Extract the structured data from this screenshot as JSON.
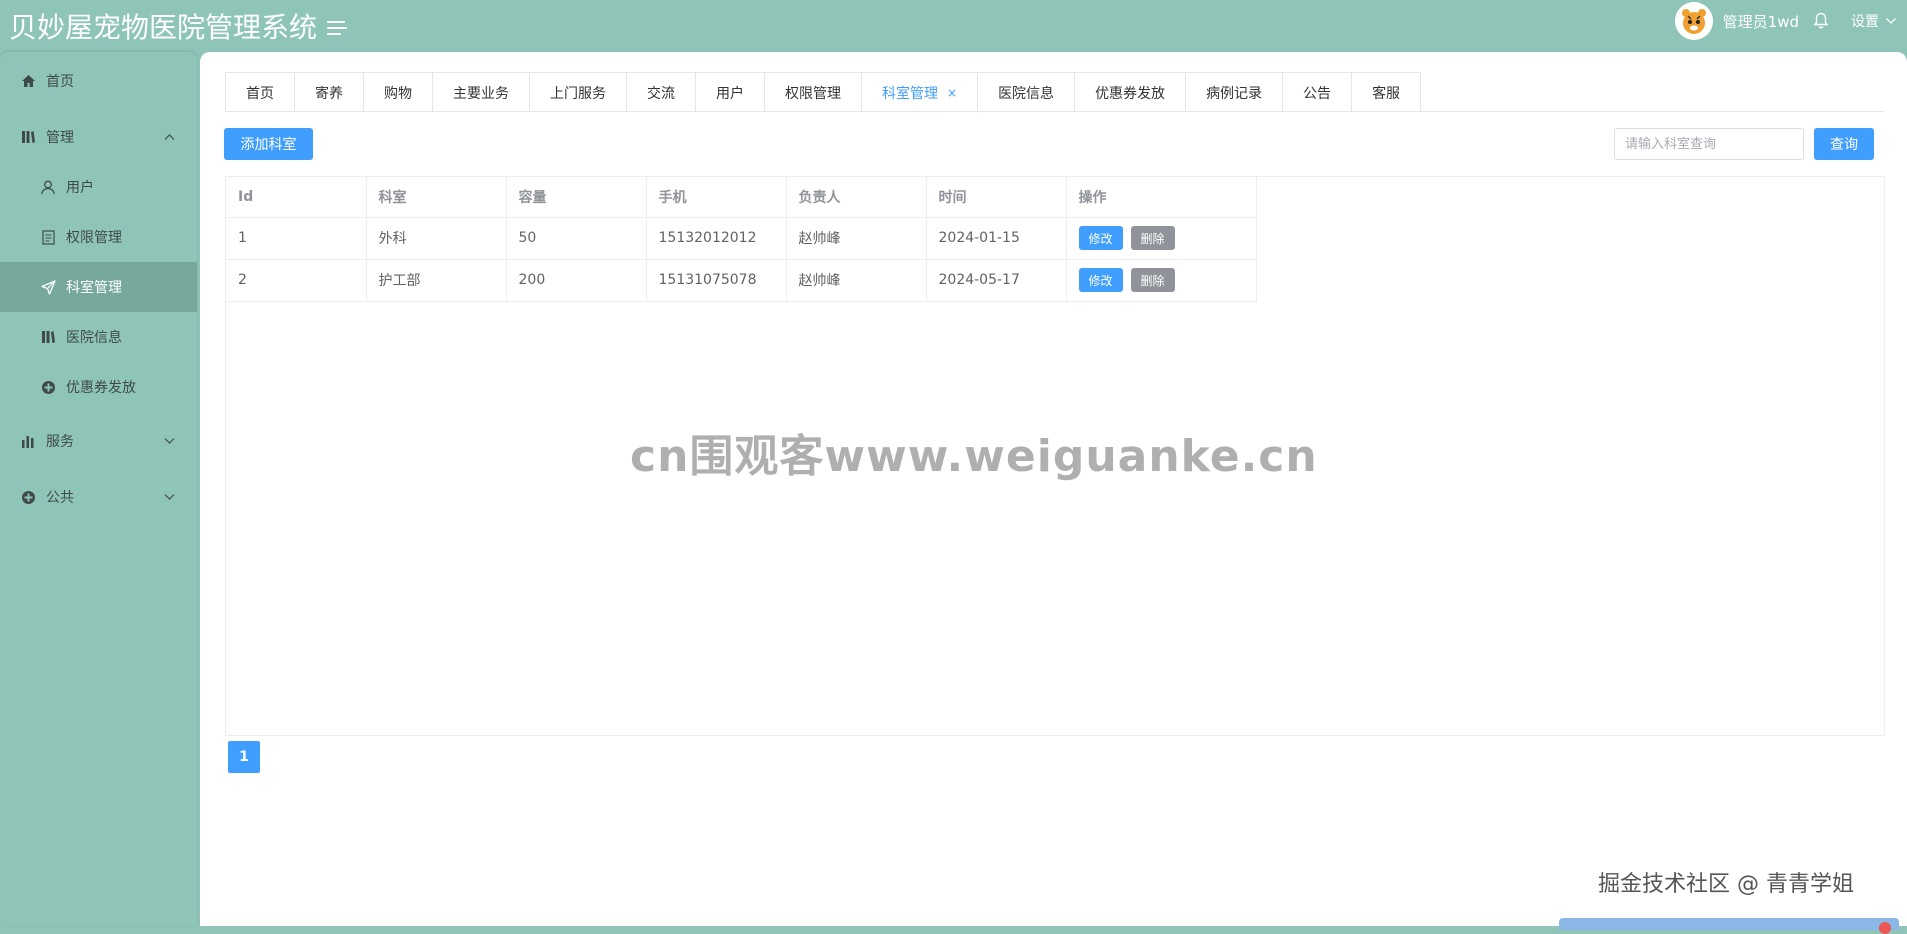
{
  "header": {
    "app_title": "贝妙屋宠物医院管理系统",
    "username": "管理员1wd",
    "settings_label": "设置"
  },
  "sidebar": {
    "items": [
      {
        "label": "首页",
        "icon": "home-icon"
      },
      {
        "label": "管理",
        "icon": "book-icon"
      },
      {
        "label": "用户",
        "icon": "user-icon"
      },
      {
        "label": "权限管理",
        "icon": "document-icon"
      },
      {
        "label": "科室管理",
        "icon": "send-icon"
      },
      {
        "label": "医院信息",
        "icon": "book-icon"
      },
      {
        "label": "优惠券发放",
        "icon": "circle-plus-icon"
      },
      {
        "label": "服务",
        "icon": "bar-chart-icon"
      },
      {
        "label": "公共",
        "icon": "circle-plus-icon"
      }
    ]
  },
  "tabs": [
    {
      "label": "首页"
    },
    {
      "label": "寄养"
    },
    {
      "label": "购物"
    },
    {
      "label": "主要业务"
    },
    {
      "label": "上门服务"
    },
    {
      "label": "交流"
    },
    {
      "label": "用户"
    },
    {
      "label": "权限管理"
    },
    {
      "label": "科室管理",
      "close": "×"
    },
    {
      "label": "医院信息"
    },
    {
      "label": "优惠券发放"
    },
    {
      "label": "病例记录"
    },
    {
      "label": "公告"
    },
    {
      "label": "客服"
    }
  ],
  "toolbar": {
    "add_label": "添加科室",
    "search_placeholder": "请输入科室查询",
    "search_label": "查询"
  },
  "table": {
    "headers": [
      "Id",
      "科室",
      "容量",
      "手机",
      "负责人",
      "时间",
      "操作"
    ],
    "rows": [
      [
        "1",
        "外科",
        "50",
        "15132012012",
        "赵帅峰",
        "2024-01-15"
      ],
      [
        "2",
        "护工部",
        "200",
        "15131075078",
        "赵帅峰",
        "2024-05-17"
      ]
    ],
    "edit_label": "修改",
    "delete_label": "删除"
  },
  "pagination": {
    "current": "1"
  },
  "watermark": "cn围观客www.weiguanke.cn",
  "credit": "掘金技术社区 @ 青青学姐",
  "colors": {
    "theme": "#8fc5b9",
    "primary": "#409eff",
    "active_menu": "#77a89c"
  }
}
